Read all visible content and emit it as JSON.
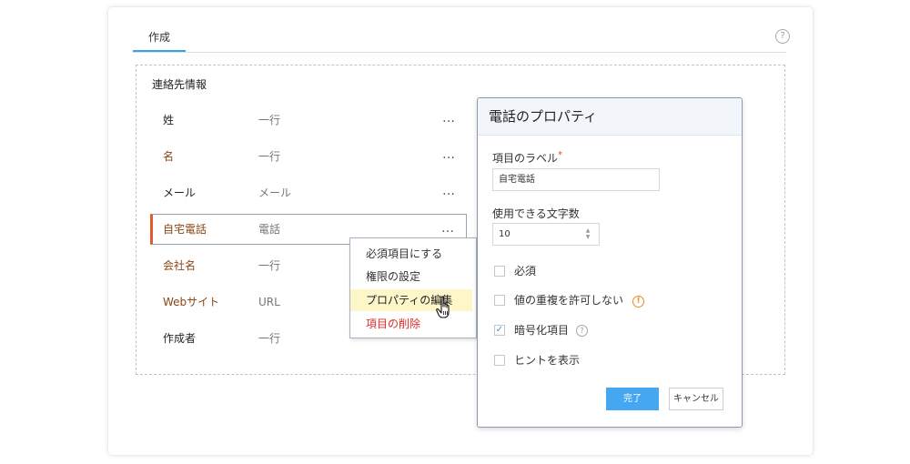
{
  "tabs": [
    {
      "label": "作成"
    }
  ],
  "help_icon": "?",
  "section": {
    "title": "連絡先情報",
    "fields": [
      {
        "label": "姓",
        "type": "一行",
        "more": "…",
        "label_color": "#222222"
      },
      {
        "label": "名",
        "type": "一行",
        "more": "…",
        "label_color": "#8b4513"
      },
      {
        "label": "メール",
        "type": "メール",
        "more": "…",
        "label_color": "#222222"
      },
      {
        "label": "自宅電話",
        "type": "電話",
        "more": "…",
        "label_color": "#8b4513"
      },
      {
        "label": "会社名",
        "type": "一行",
        "label_color": "#8b4513"
      },
      {
        "label": "Webサイト",
        "type": "URL",
        "label_color": "#8b4513"
      },
      {
        "label": "作成者",
        "type": "一行",
        "label_color": "#222222"
      }
    ]
  },
  "context_menu": {
    "items": [
      {
        "label": "必須項目にする"
      },
      {
        "label": "権限の設定"
      },
      {
        "label": "プロパティの編集"
      },
      {
        "label": "項目の削除"
      }
    ]
  },
  "dialog": {
    "title": "電話のプロパティ",
    "label_field": {
      "label": "項目のラベル",
      "required_marker": "*",
      "value": "自宅電話"
    },
    "max_chars": {
      "label": "使用できる文字数",
      "value": "10"
    },
    "checkboxes": [
      {
        "label": "必須",
        "checked": false
      },
      {
        "label": "値の重複を許可しない",
        "checked": false,
        "icon": "warning-icon"
      },
      {
        "label": "暗号化項目",
        "checked": true,
        "icon": "info-icon"
      },
      {
        "label": "ヒントを表示",
        "checked": false
      }
    ],
    "done_label": "完了",
    "cancel_label": "キャンセル"
  },
  "colors": {
    "accent": "#45a6f2",
    "selected_border": "#e35b2c",
    "danger": "#e02b2b",
    "highlight": "#fdf6c8",
    "warning": "#f08a24"
  }
}
